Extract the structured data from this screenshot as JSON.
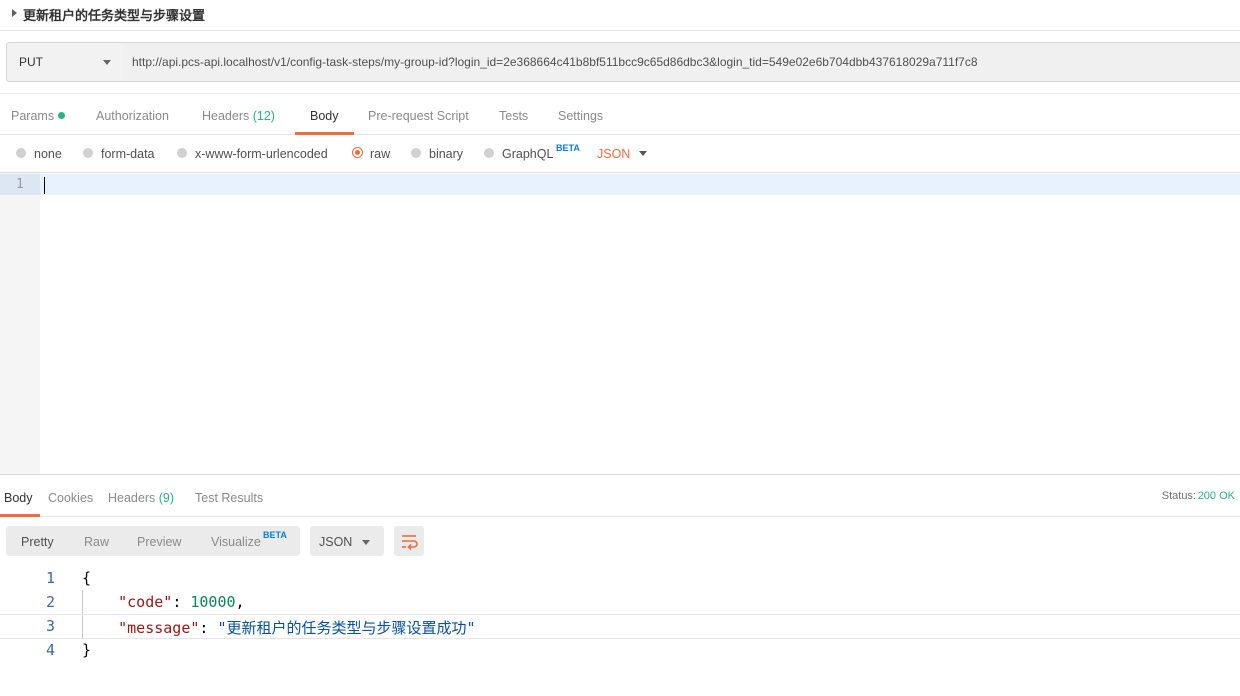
{
  "request": {
    "title": "更新租户的任务类型与步骤设置",
    "method": "PUT",
    "url": "http://api.pcs-api.localhost/v1/config-task-steps/my-group-id?login_id=2e368664c41b8bf511bcc9c65d86dbc3&login_tid=549e02e6b704dbb437618029a711f7c8"
  },
  "request_tabs": {
    "params": "Params",
    "authorization": "Authorization",
    "headers": "Headers",
    "headers_count": "(12)",
    "body": "Body",
    "prerequest": "Pre-request Script",
    "tests": "Tests",
    "settings": "Settings",
    "active": "Body"
  },
  "body_types": {
    "none": "none",
    "form_data": "form-data",
    "urlencoded": "x-www-form-urlencoded",
    "raw": "raw",
    "binary": "binary",
    "graphql": "GraphQL",
    "graphql_badge": "BETA",
    "selected": "raw",
    "language": "JSON"
  },
  "editor": {
    "line_numbers": [
      "1"
    ]
  },
  "response_tabs": {
    "body": "Body",
    "cookies": "Cookies",
    "headers": "Headers",
    "headers_count": "(9)",
    "test_results": "Test Results",
    "active": "Body"
  },
  "status": {
    "label": "Status:",
    "value": "200 OK",
    "color": "#26b47f"
  },
  "response_toolbar": {
    "pretty": "Pretty",
    "raw": "Raw",
    "preview": "Preview",
    "visualize": "Visualize",
    "visualize_badge": "BETA",
    "active": "Pretty",
    "format": "JSON",
    "wrap_icon": "wrap-lines-icon"
  },
  "response_body": {
    "line_numbers": [
      "1",
      "2",
      "3",
      "4"
    ],
    "open_brace": "{",
    "close_brace": "}",
    "code_key": "\"code\"",
    "code_value": "10000",
    "message_key": "\"message\"",
    "message_value": "\"更新租户的任务类型与步骤设置成功\""
  },
  "colors": {
    "accent": "#f26b3a",
    "success": "#26b47f",
    "beta": "#097bed"
  }
}
